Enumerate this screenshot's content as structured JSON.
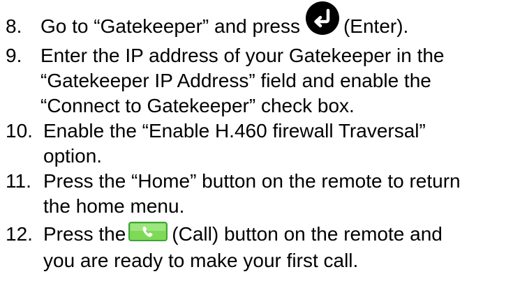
{
  "steps": [
    {
      "number": "8.",
      "text_before_icon": "Go to “Gatekeeper” and press",
      "icon": "enter-icon",
      "text_after_icon": "(Enter)."
    },
    {
      "number": "9.",
      "lines": [
        "Enter the IP address of your Gatekeeper in the",
        "“Gatekeeper IP Address” field and enable the",
        "“Connect to Gatekeeper” check box."
      ]
    },
    {
      "number": "10.",
      "lines": [
        "Enable the “Enable H.460 firewall Traversal”",
        "option."
      ]
    },
    {
      "number": "11.",
      "lines": [
        "Press the “Home” button on the remote to return",
        "the home menu."
      ]
    },
    {
      "number": "12.",
      "text_before_icon": "Press the",
      "icon": "call-icon",
      "text_after_icon": "(Call) button on the remote and",
      "continuation": "you are ready to make your first call."
    }
  ],
  "colors": {
    "text": "#000000",
    "enter_icon_bg": "#000000",
    "call_icon_bg": "#7ed957",
    "call_icon_border": "#3fa33a"
  }
}
